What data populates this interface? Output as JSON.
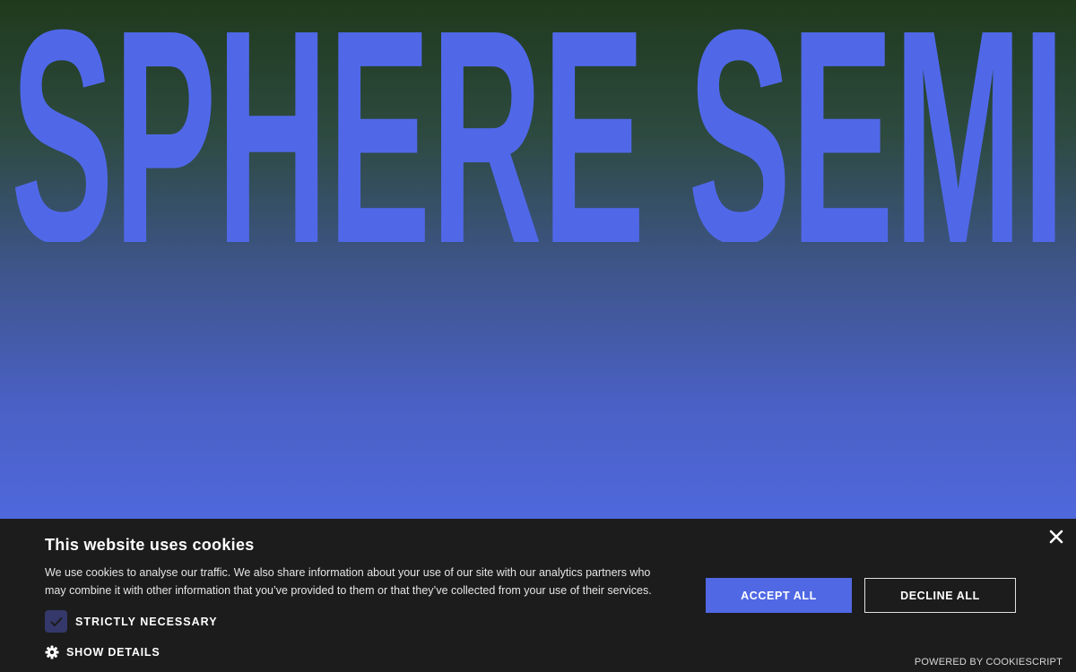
{
  "hero": {
    "title": "SPHERE SEMI",
    "title_color": "#5068e8"
  },
  "cookie": {
    "heading": "This website uses cookies",
    "text": "We use cookies to analyse our traffic. We also share information about your use of our site with our analytics partners who may combine it with other information that you’ve provided to them or that they’ve collected from your use of their services.",
    "strictly_necessary_label": "STRICTLY NECESSARY",
    "strictly_necessary_checked": true,
    "show_details_label": "SHOW DETAILS",
    "accept_label": "ACCEPT ALL",
    "decline_label": "DECLINE ALL",
    "powered_by": "POWERED BY COOKIESCRIPT",
    "accent_color": "#5068e4",
    "background_color": "#1c1c1c",
    "icons": {
      "close": "close-icon",
      "check": "check-icon",
      "settings": "gear-icon"
    }
  }
}
